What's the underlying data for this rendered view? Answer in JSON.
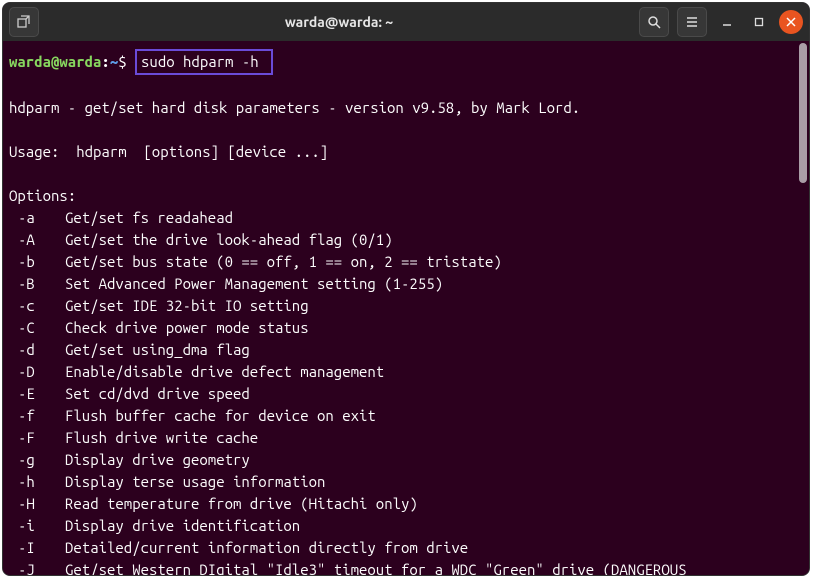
{
  "window": {
    "title": "warda@warda: ~"
  },
  "prompt": {
    "user_host": "warda@warda",
    "sep1": ":",
    "path": "~",
    "dollar": "$",
    "command": "sudo hdparm -h"
  },
  "output": {
    "blank1": "",
    "header": "hdparm - get/set hard disk parameters - version v9.58, by Mark Lord.",
    "blank2": "",
    "usage": "Usage:  hdparm  [options] [device ...]",
    "blank3": "",
    "options_title": "Options:",
    "options": [
      {
        "flag": "-a",
        "desc": "Get/set fs readahead"
      },
      {
        "flag": "-A",
        "desc": "Get/set the drive look-ahead flag (0/1)"
      },
      {
        "flag": "-b",
        "desc": "Get/set bus state (0 == off, 1 == on, 2 == tristate)"
      },
      {
        "flag": "-B",
        "desc": "Set Advanced Power Management setting (1-255)"
      },
      {
        "flag": "-c",
        "desc": "Get/set IDE 32-bit IO setting"
      },
      {
        "flag": "-C",
        "desc": "Check drive power mode status"
      },
      {
        "flag": "-d",
        "desc": "Get/set using_dma flag"
      },
      {
        "flag": "-D",
        "desc": "Enable/disable drive defect management"
      },
      {
        "flag": "-E",
        "desc": "Set cd/dvd drive speed"
      },
      {
        "flag": "-f",
        "desc": "Flush buffer cache for device on exit"
      },
      {
        "flag": "-F",
        "desc": "Flush drive write cache"
      },
      {
        "flag": "-g",
        "desc": "Display drive geometry"
      },
      {
        "flag": "-h",
        "desc": "Display terse usage information"
      },
      {
        "flag": "-H",
        "desc": "Read temperature from drive (Hitachi only)"
      },
      {
        "flag": "-i",
        "desc": "Display drive identification"
      },
      {
        "flag": "-I",
        "desc": "Detailed/current information directly from drive"
      },
      {
        "flag": "-J",
        "desc": "Get/set Western DIgital \"Idle3\" timeout for a WDC \"Green\" drive (DANGEROUS"
      }
    ]
  }
}
